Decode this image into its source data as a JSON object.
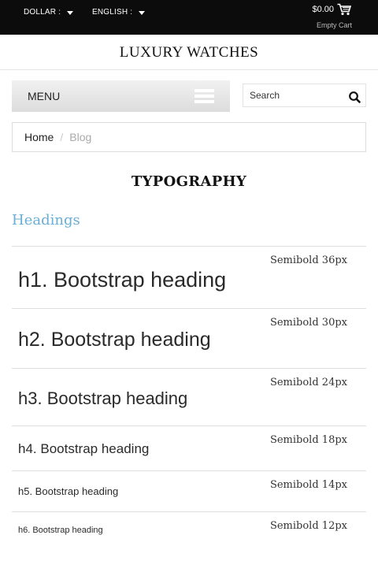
{
  "topbar": {
    "currency_label": "DOLLAR :",
    "language_label": "ENGLISH :",
    "cart_total": "$0.00",
    "cart_status": "Empty Cart",
    "cart_icon": "shopping-cart-icon"
  },
  "site": {
    "title": "LUXURY WATCHES"
  },
  "menu": {
    "label": "MENU",
    "toggle_icon": "menu-toggle-icon"
  },
  "search": {
    "placeholder": "Search",
    "icon": "search-icon"
  },
  "breadcrumb": {
    "home": "Home",
    "separator": "/",
    "current": "Blog"
  },
  "page": {
    "title": "TYPOGRAPHY",
    "section": "Headings"
  },
  "headings": [
    {
      "sample": "h1. Bootstrap heading",
      "note": "Semibold 36px"
    },
    {
      "sample": "h2. Bootstrap heading",
      "note": "Semibold 30px"
    },
    {
      "sample": "h3. Bootstrap heading",
      "note": "Semibold 24px"
    },
    {
      "sample": "h4. Bootstrap heading",
      "note": "Semibold 18px"
    },
    {
      "sample": "h5. Bootstrap heading",
      "note": "Semibold 14px"
    },
    {
      "sample": "h6. Bootstrap heading",
      "note": "Semibold 12px"
    }
  ],
  "colors": {
    "topbar_bg": "#0c0c0c",
    "section_accent": "#6aaed6"
  }
}
